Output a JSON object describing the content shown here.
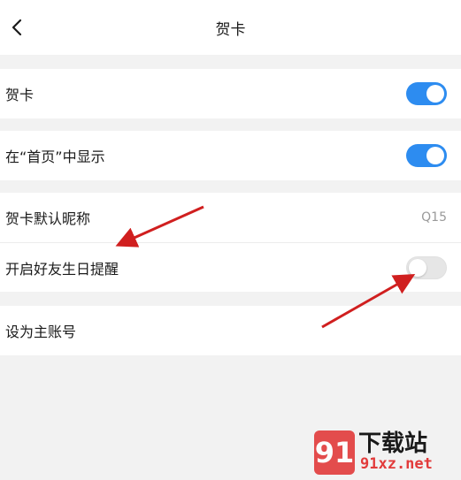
{
  "header": {
    "title": "贺卡",
    "back_icon": "chevron-left-icon"
  },
  "settings": {
    "greeting_card": {
      "label": "贺卡",
      "enabled": true
    },
    "show_on_home": {
      "label": "在“首页”中显示",
      "enabled": true
    },
    "default_nickname": {
      "label": "贺卡默认昵称",
      "value": "Q15"
    },
    "birthday_reminder": {
      "label": "开启好友生日提醒",
      "enabled": false
    },
    "set_primary": {
      "label": "设为主账号"
    }
  },
  "colors": {
    "accent": "#2d8cf0",
    "arrow": "#d01f1f",
    "toggle_off": "#e6e6e6"
  },
  "watermark": {
    "badge": "91",
    "top": "下载站",
    "bottom": "91xz.net"
  }
}
